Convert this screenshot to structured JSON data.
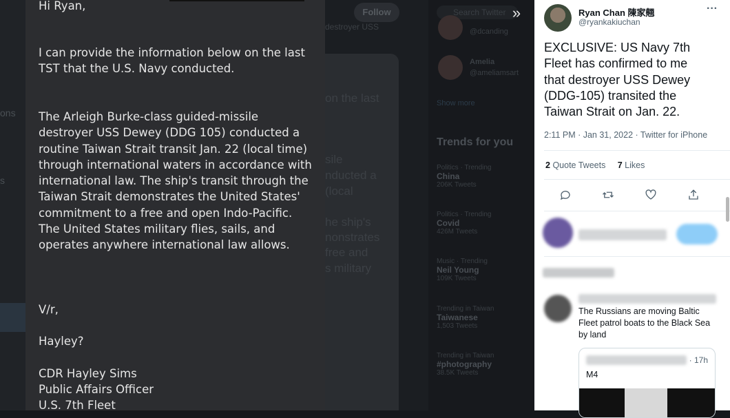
{
  "email": {
    "greeting": "Hi Ryan,",
    "intro": "I can provide the information below on the last TST that the U.S. Navy conducted.",
    "body": "The Arleigh Burke-class guided-missile destroyer USS Dewey (DDG 105) conducted a routine Taiwan Strait transit Jan. 22 (local time) through international waters in accordance with international law. The ship's transit through the Taiwan Strait demonstrates the United States' commitment to a free and open Indo-Pacific. The United States military flies, sails, and operates anywhere international law allows.",
    "closing": "V/r,",
    "name_question": "Hayley?",
    "signature_name": "CDR Hayley Sims",
    "signature_title": "Public Affairs Officer",
    "signature_org": "U.S. 7th Fleet"
  },
  "background": {
    "follow_label": "Follow",
    "search_placeholder": "Search Twitter",
    "trends_title": "Trends for you",
    "show_more": "Show more",
    "left_fragments": [
      "ons",
      "s"
    ],
    "people": [
      {
        "name": "",
        "handle": "@dcanding"
      },
      {
        "name": "Amelia",
        "handle": "@ameliamsart"
      }
    ],
    "trends": [
      {
        "meta": "Politics · Trending",
        "name": "China",
        "count": "206K Tweets"
      },
      {
        "meta": "Politics · Trending",
        "name": "Covid",
        "count": "426M Tweets"
      },
      {
        "meta": "Music · Trending",
        "name": "Neil Young",
        "count": "109K Tweets"
      },
      {
        "meta": "Trending in Taiwan",
        "name": "Taiwanese",
        "count": "1,503 Tweets"
      },
      {
        "meta": "Trending in Taiwan",
        "name": "#photography",
        "count": "38.5K Tweets"
      }
    ],
    "center_ghosts": [
      "destroyer USS",
      "on the last",
      "sile",
      "nducted a",
      "(local",
      "he ship's",
      "nonstrates",
      "free and",
      "s military"
    ]
  },
  "tweet": {
    "author_name": "Ryan Chan 陳家翹",
    "author_handle": "@ryankakiuchan",
    "text": "EXCLUSIVE: US Navy 7th Fleet has confirmed to me that destroyer USS Dewey (DDG-105) transited the Taiwan Strait on Jan. 22.",
    "timestamp": "2:11 PM · Jan 31, 2022 · Twitter for iPhone",
    "quote_count": "2",
    "quote_label": "Quote Tweets",
    "like_count": "7",
    "like_label": "Likes",
    "reply_text": "The Russians are moving Baltic Fleet patrol boats to the Black Sea by land",
    "quoted_time": "· 17h",
    "quoted_text": "M4"
  },
  "colors": {
    "email_bg": "#2c2d30",
    "tweet_bg": "#ffffff",
    "dim_bg": "#15181c",
    "follow_blue": "#1d9bf0"
  }
}
